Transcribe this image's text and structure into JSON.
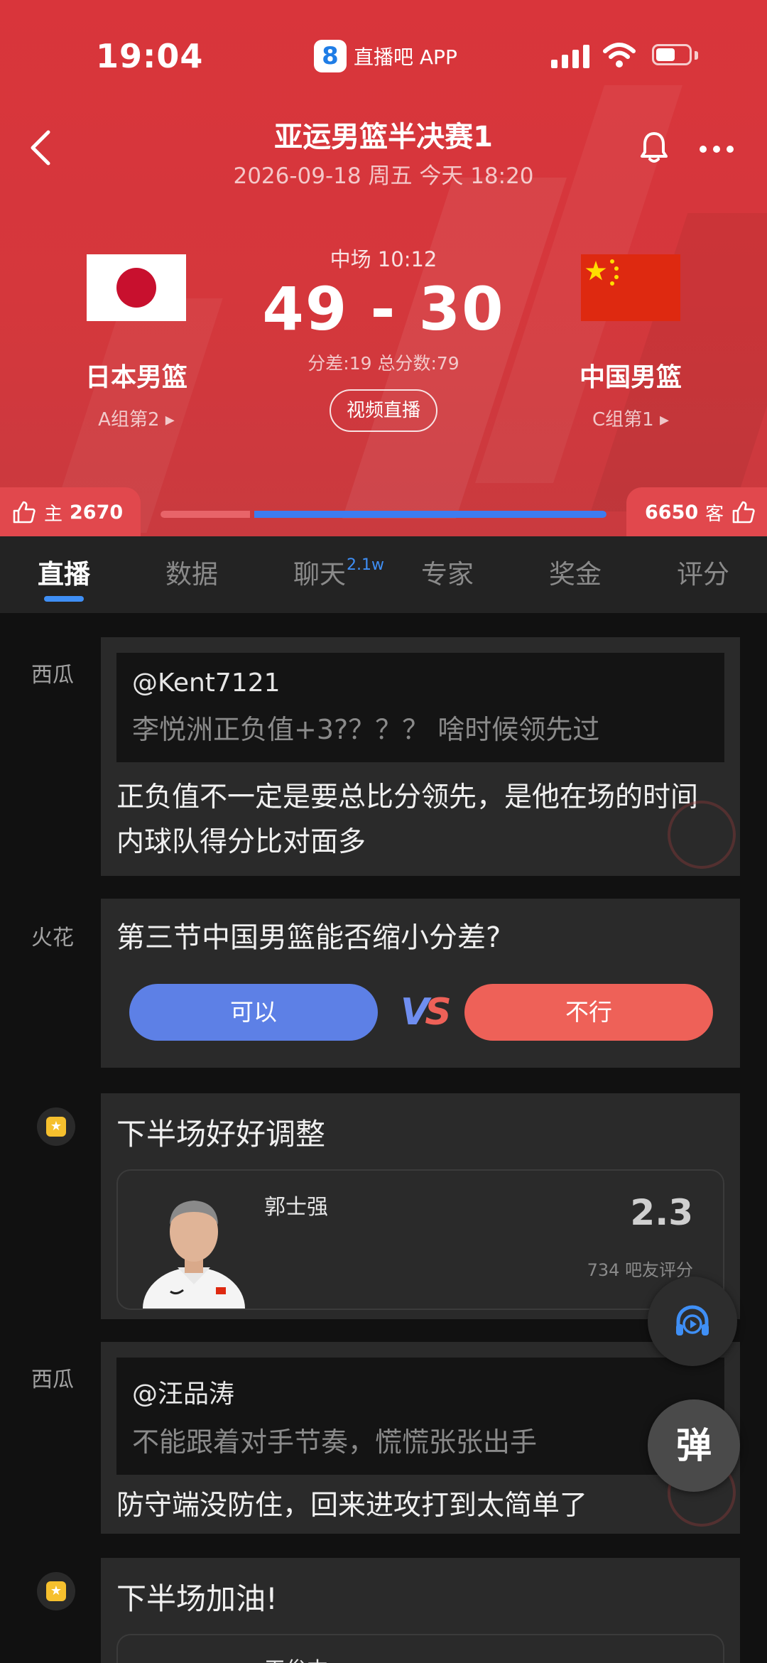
{
  "status_bar": {
    "time": "19:04",
    "app_logo": "8",
    "app_name": "直播吧 APP"
  },
  "header": {
    "title": "亚运男篮半决赛1",
    "subtitle": "2026-09-18 周五 今天 18:20",
    "period": "中场 10:12",
    "score": "49 - 30",
    "stats": "分差:19 总分数:79",
    "live_button": "视频直播",
    "home": {
      "name": "日本男篮",
      "group": "A组第2 ▸",
      "flag": "japan-flag"
    },
    "away": {
      "name": "中国男篮",
      "group": "C组第1 ▸",
      "flag": "china-flag"
    }
  },
  "support": {
    "home_label": "主",
    "home_count": "2670",
    "away_label": "客",
    "away_count": "6650",
    "home_share": 0.2
  },
  "tabs": [
    {
      "label": "直播",
      "active": true
    },
    {
      "label": "数据"
    },
    {
      "label": "聊天",
      "badge": "2.1w"
    },
    {
      "label": "专家"
    },
    {
      "label": "奖金"
    },
    {
      "label": "评分"
    }
  ],
  "feed": {
    "post1": {
      "source": "西瓜",
      "quote_user": "@Kent7121",
      "quote_text": "李悦洲正负值+3?？？？ 啥时候领先过",
      "reply": "正负值不一定是要总比分领先，是他在场的时间内球队得分比对面多"
    },
    "poll": {
      "source": "火花",
      "question": "第三节中国男篮能否缩小分差?",
      "yes": "可以",
      "no": "不行",
      "vs_v": "V",
      "vs_s": "S"
    },
    "rating1": {
      "title": "下半场好好调整",
      "coach": "郭士强",
      "score": "2.3",
      "votes": "734 吧友评分"
    },
    "post2": {
      "source": "西瓜",
      "quote_user": "@汪品涛",
      "quote_text": "不能跟着对手节奏，慌慌张张出手",
      "reply": "防守端没防住，回来进攻打到太简单了"
    },
    "rating2": {
      "title": "下半场加油!",
      "coach": "王俊杰"
    }
  },
  "fab": {
    "danmu_label": "弹"
  },
  "colors": {
    "header_red": "#d9353b",
    "accent_blue": "#3f8ff5",
    "poll_yes": "#5d80e6",
    "poll_no": "#ee6158"
  }
}
